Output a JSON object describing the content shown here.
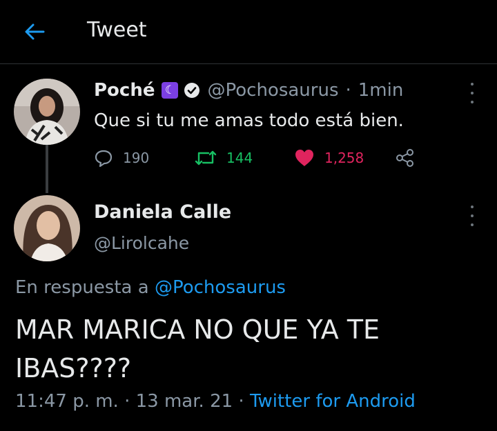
{
  "header": {
    "title": "Tweet"
  },
  "original_tweet": {
    "name": "Poché",
    "badge": "☾",
    "handle": "@Pochosaurus",
    "separator": "·",
    "time": "1min",
    "text": "Que si tu me amas todo está bien.",
    "reply_count": "190",
    "retweet_count": "144",
    "like_count": "1,258",
    "colors": {
      "retweet": "#17bf63",
      "like": "#e0245e",
      "badge": "#7b3fe4"
    }
  },
  "reply_tweet": {
    "name": "Daniela Calle",
    "handle": "@Lirolcahe",
    "in_reply_prefix": "En respuesta a",
    "in_reply_handle": "@Pochosaurus",
    "text": "MAR MARICA NO QUE YA TE IBAS????",
    "time": "11:47 p. m.",
    "sep1": "·",
    "date": "13 mar. 21",
    "sep2": "·",
    "source": "Twitter for Android"
  },
  "icons": [
    "back-arrow-icon",
    "verified-icon",
    "reply-icon",
    "retweet-icon",
    "heart-icon",
    "share-icon",
    "more-options-icon"
  ]
}
